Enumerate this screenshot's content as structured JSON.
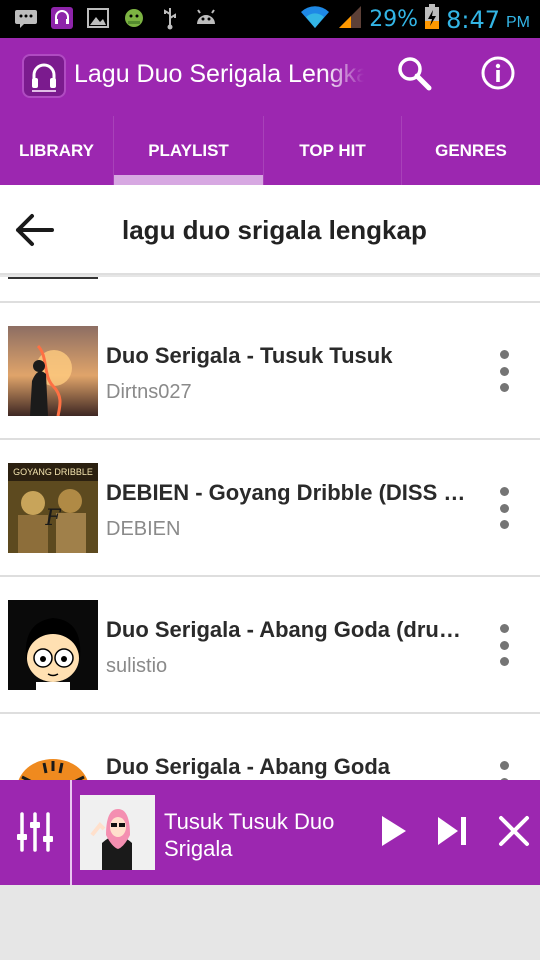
{
  "status_bar": {
    "battery_percent": "29%",
    "time": "8:47",
    "ampm": "PM",
    "left_icons": [
      "bbm-icon",
      "headphones-app-icon",
      "image-icon",
      "android-icon",
      "usb-icon",
      "android-debug-icon"
    ],
    "right_icons": [
      "wifi-icon",
      "signal-icon",
      "battery-charging-icon"
    ]
  },
  "app_bar": {
    "title": "Lagu Duo Serigala Lengkap",
    "actions": [
      "search-icon",
      "info-icon"
    ]
  },
  "tabs": [
    {
      "label": "LIBRARY",
      "active": false
    },
    {
      "label": "PLAYLIST",
      "active": true
    },
    {
      "label": "TOP HIT",
      "active": false
    },
    {
      "label": "GENRES",
      "active": false
    }
  ],
  "search_header": {
    "query": "lagu duo srigala lengkap"
  },
  "tracks": [
    {
      "title": "Duo Serigala - Tusuk Tusuk",
      "artist": "Dirtns027"
    },
    {
      "title": "DEBIEN - Goyang Dribble (DISS DUO SERIGALA)",
      "artist": "DEBIEN",
      "thumb_caption": "GOYANG DRIBBLE"
    },
    {
      "title": "Duo Serigala - Abang Goda (drum cover)",
      "artist": "sulistio"
    },
    {
      "title": "Duo Serigala - Abang Goda",
      "artist": ""
    }
  ],
  "now_playing": {
    "title": "Tusuk Tusuk Duo Srigala"
  },
  "colors": {
    "accent": "#9c27b0",
    "tab_indicator": "#d7a8e2",
    "status_text": "#33b5e5"
  }
}
